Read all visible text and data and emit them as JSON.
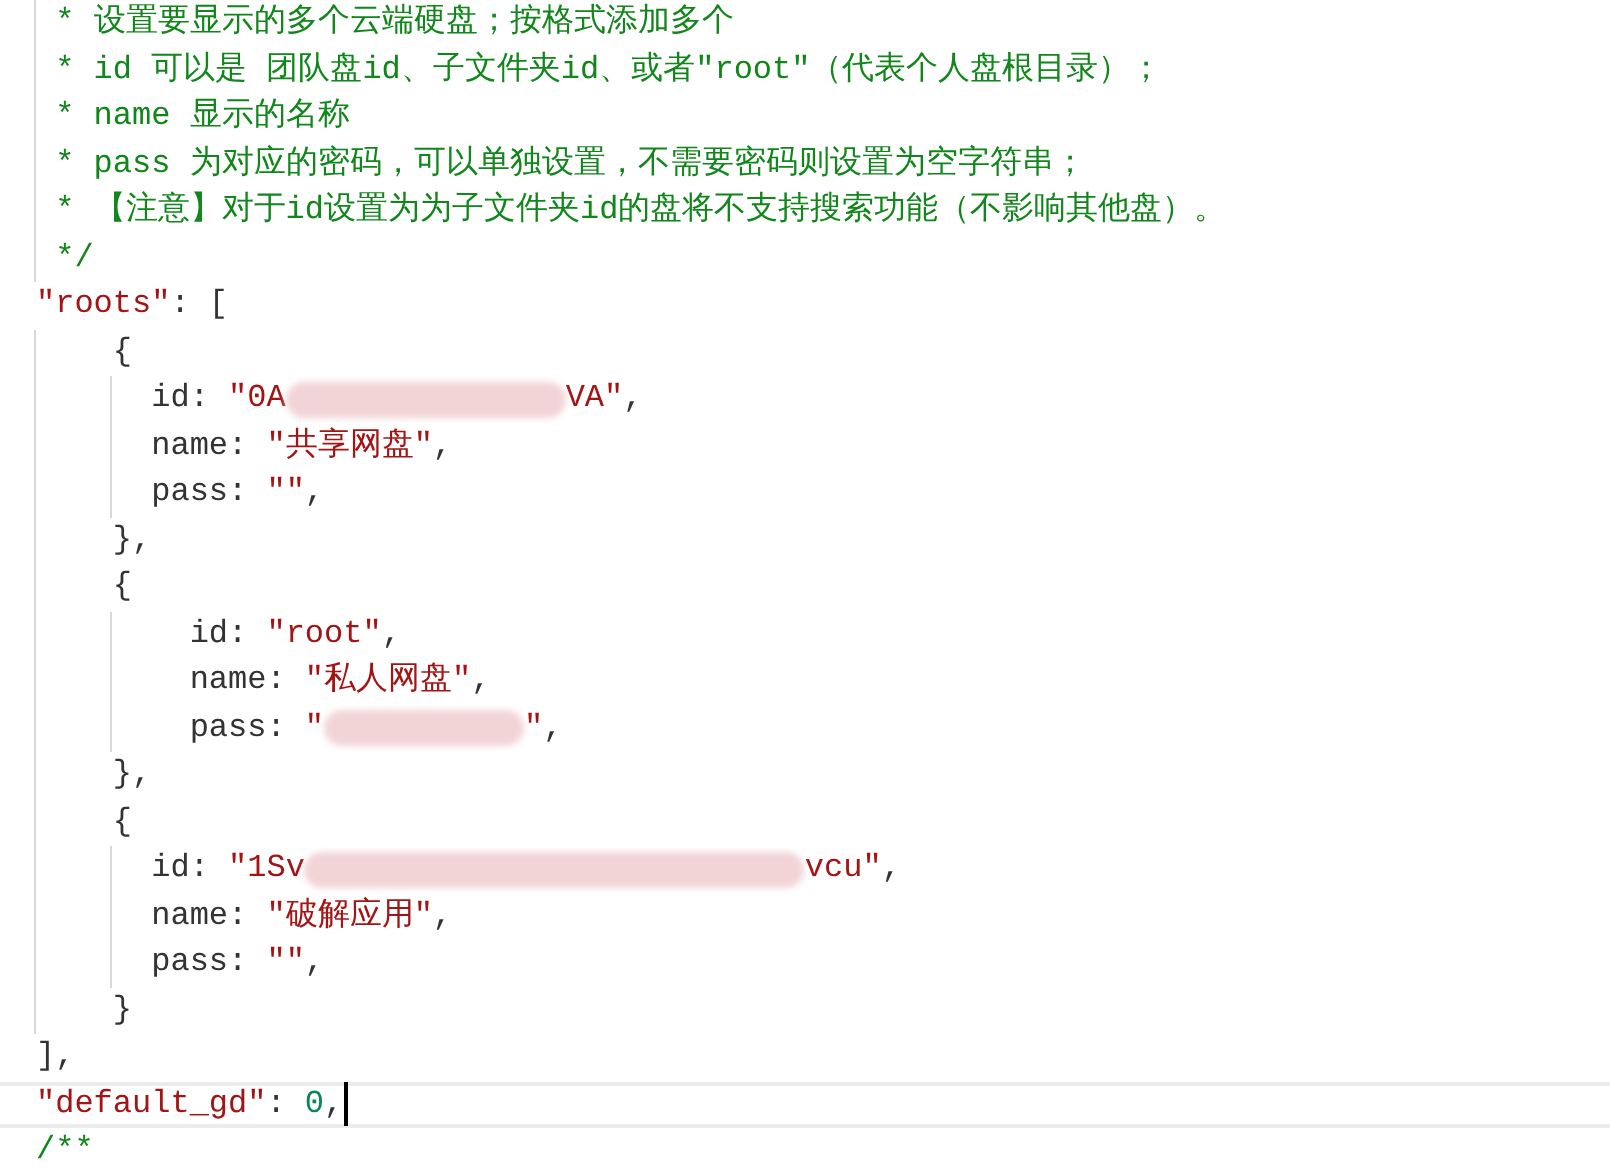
{
  "editor": {
    "lines": [
      {
        "tokens": [
          {
            "kind": "comment",
            "text": " * 设置要显示的多个云端硬盘；按格式添加多个"
          }
        ]
      },
      {
        "tokens": [
          {
            "kind": "comment",
            "text": " * id 可以是 团队盘id、子文件夹id、或者\"root\"（代表个人盘根目录）；"
          }
        ]
      },
      {
        "tokens": [
          {
            "kind": "comment",
            "text": " * name 显示的名称"
          }
        ]
      },
      {
        "tokens": [
          {
            "kind": "comment",
            "text": " * pass 为对应的密码，可以单独设置，不需要密码则设置为空字符串；"
          }
        ]
      },
      {
        "tokens": [
          {
            "kind": "comment",
            "text": " * 【注意】对于id设置为为子文件夹id的盘将不支持搜索功能（不影响其他盘）。"
          }
        ]
      },
      {
        "tokens": [
          {
            "kind": "comment",
            "text": " */"
          }
        ]
      },
      {
        "tokens": [
          {
            "kind": "string",
            "text": "\"roots\""
          },
          {
            "kind": "plain",
            "text": ": ["
          }
        ]
      },
      {
        "tokens": [
          {
            "kind": "plain",
            "text": "    {"
          }
        ]
      },
      {
        "tokens": [
          {
            "kind": "plain",
            "text": "      id: "
          },
          {
            "kind": "string",
            "text": "\"0A"
          },
          {
            "kind": "redacted_medium"
          },
          {
            "kind": "string",
            "text": "VA\""
          },
          {
            "kind": "plain",
            "text": ","
          }
        ]
      },
      {
        "tokens": [
          {
            "kind": "plain",
            "text": "      name: "
          },
          {
            "kind": "string",
            "text": "\"共享网盘\""
          },
          {
            "kind": "plain",
            "text": ","
          }
        ]
      },
      {
        "tokens": [
          {
            "kind": "plain",
            "text": "      pass: "
          },
          {
            "kind": "string",
            "text": "\"\""
          },
          {
            "kind": "plain",
            "text": ","
          }
        ]
      },
      {
        "tokens": [
          {
            "kind": "plain",
            "text": "    },"
          }
        ]
      },
      {
        "tokens": [
          {
            "kind": "plain",
            "text": "    {"
          }
        ]
      },
      {
        "tokens": [
          {
            "kind": "plain",
            "text": "        id: "
          },
          {
            "kind": "string",
            "text": "\"root\""
          },
          {
            "kind": "plain",
            "text": ","
          }
        ]
      },
      {
        "tokens": [
          {
            "kind": "plain",
            "text": "        name: "
          },
          {
            "kind": "string",
            "text": "\"私人网盘\""
          },
          {
            "kind": "plain",
            "text": ","
          }
        ]
      },
      {
        "tokens": [
          {
            "kind": "plain",
            "text": "        pass: "
          },
          {
            "kind": "string",
            "text": "\""
          },
          {
            "kind": "redacted_short"
          },
          {
            "kind": "string",
            "text": "\""
          },
          {
            "kind": "plain",
            "text": ","
          }
        ]
      },
      {
        "tokens": [
          {
            "kind": "plain",
            "text": "    },"
          }
        ]
      },
      {
        "tokens": [
          {
            "kind": "plain",
            "text": "    {"
          }
        ]
      },
      {
        "tokens": [
          {
            "kind": "plain",
            "text": "      id: "
          },
          {
            "kind": "string",
            "text": "\"1Sv"
          },
          {
            "kind": "redacted_long"
          },
          {
            "kind": "string",
            "text": "vcu\""
          },
          {
            "kind": "plain",
            "text": ","
          }
        ]
      },
      {
        "tokens": [
          {
            "kind": "plain",
            "text": "      name: "
          },
          {
            "kind": "string",
            "text": "\"破解应用\""
          },
          {
            "kind": "plain",
            "text": ","
          }
        ]
      },
      {
        "tokens": [
          {
            "kind": "plain",
            "text": "      pass: "
          },
          {
            "kind": "string",
            "text": "\"\""
          },
          {
            "kind": "plain",
            "text": ","
          }
        ]
      },
      {
        "tokens": [
          {
            "kind": "plain",
            "text": "    }"
          }
        ]
      },
      {
        "tokens": [
          {
            "kind": "plain",
            "text": "],"
          }
        ]
      },
      {
        "current": true,
        "tokens": [
          {
            "kind": "string",
            "text": "\"default_gd\""
          },
          {
            "kind": "plain",
            "text": ": "
          },
          {
            "kind": "number",
            "text": "0"
          },
          {
            "kind": "plain",
            "text": ","
          }
        ]
      },
      {
        "tokens": [
          {
            "kind": "comment",
            "text": "/**"
          }
        ]
      }
    ]
  }
}
